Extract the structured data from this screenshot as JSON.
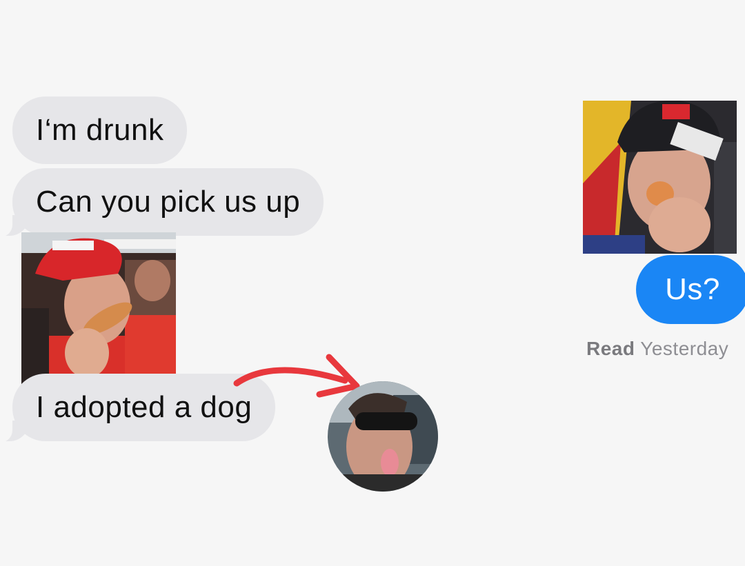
{
  "messages": {
    "m1": "I‘m drunk",
    "m2": "Can you pick us up",
    "m3": "I adopted a dog",
    "reply": "Us?"
  },
  "receipt": {
    "status": "Read",
    "time": "Yesterday"
  },
  "colors": {
    "background": "#f6f6f6",
    "received_bubble": "#e6e6e9",
    "sent_bubble": "#1a86f5",
    "arrow": "#e8383d"
  },
  "icons": {
    "arrow": "curved-arrow-icon"
  }
}
